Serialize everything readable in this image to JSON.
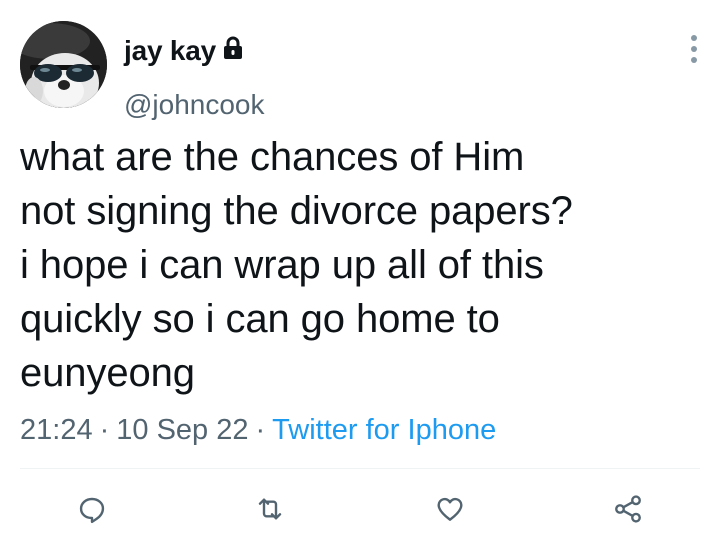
{
  "author": {
    "display_name": "jay kay",
    "handle": "@johncook",
    "protected_icon": "lock-icon",
    "avatar": "dog-with-sunglasses-avatar"
  },
  "tweet": {
    "text": "what are the chances of Him\nnot signing the divorce papers?\ni hope i can wrap up all of this\nquickly so i can go home to\neunyeong",
    "time": "21:24",
    "date": "10 Sep 22",
    "source": "Twitter for Iphone",
    "separator": "·"
  },
  "actions": [
    {
      "name": "reply",
      "icon": "reply-icon"
    },
    {
      "name": "retweet",
      "icon": "retweet-icon"
    },
    {
      "name": "like",
      "icon": "heart-icon"
    },
    {
      "name": "share",
      "icon": "share-icon"
    }
  ],
  "colors": {
    "text": "#0f1419",
    "secondary": "#536471",
    "link": "#1d9bf0",
    "divider": "#eff3f4"
  }
}
